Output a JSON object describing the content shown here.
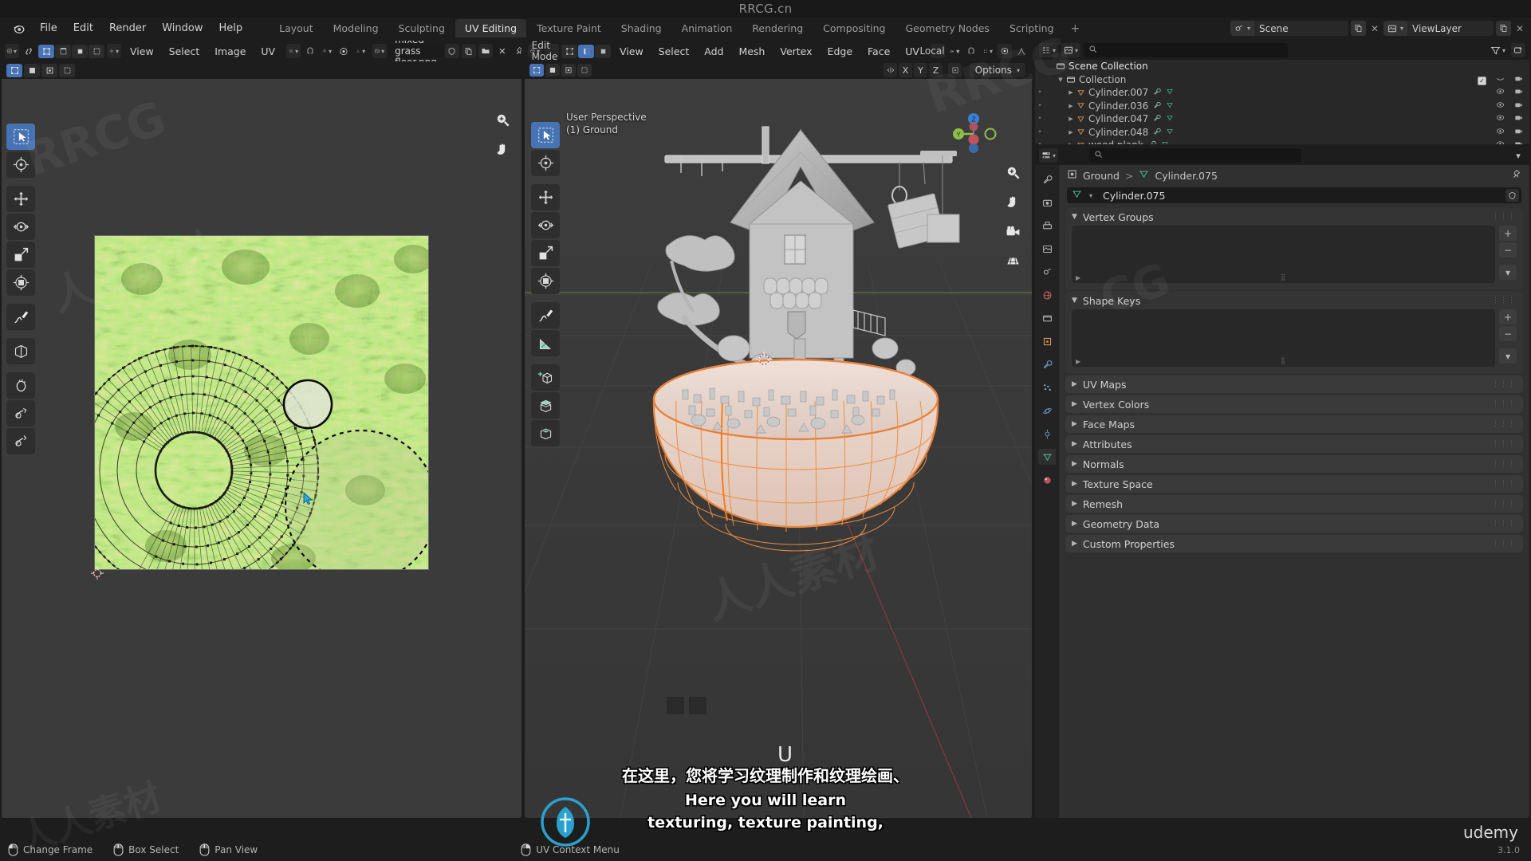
{
  "window": {
    "title": "RRCG.cn",
    "version": "3.1.0",
    "brand": "udemy"
  },
  "topbar": {
    "logo_icon": "blender-logo-icon",
    "menus": [
      "File",
      "Edit",
      "Render",
      "Window",
      "Help"
    ],
    "workspaces": [
      "Layout",
      "Modeling",
      "Sculpting",
      "UV Editing",
      "Texture Paint",
      "Shading",
      "Animation",
      "Rendering",
      "Compositing",
      "Geometry Nodes",
      "Scripting"
    ],
    "active_workspace": "UV Editing",
    "add_workspace_label": "+",
    "scene": {
      "icon": "scene-icon",
      "name": "Scene",
      "new_icon": "duplicate-icon",
      "remove_icon": "close-icon"
    },
    "viewlayer": {
      "icon": "viewlayer-icon",
      "name": "ViewLayer",
      "new_icon": "duplicate-icon",
      "remove_icon": "close-icon"
    }
  },
  "uv_editor": {
    "editor_type_icon": "uv-editor-icon",
    "mode_icon": "uv-sync-icon",
    "select_modes": [
      "vertex-select-icon",
      "edge-select-icon",
      "face-select-icon",
      "island-select-icon"
    ],
    "active_select_mode": 0,
    "pivot_icon": "pivot-icon",
    "menus": [
      "View",
      "Select",
      "Image",
      "UV"
    ],
    "snap_icon": "snap-magnet-icon",
    "proportional_icon": "proportional-edit-icon",
    "image_browse_icon": "image-browse-icon",
    "image_name": "mixed grass floor.png",
    "image_buttons": [
      "fake-user-shield-icon",
      "new-image-icon",
      "open-image-icon",
      "unlink-icon",
      "pin-icon"
    ],
    "zoom_icon": "zoom-icon",
    "pan_icon": "hand-pan-icon",
    "tools": [
      "tweak-select-tool-icon",
      "cursor-tool-icon",
      "move-tool-icon",
      "rotate-tool-icon",
      "scale-tool-icon",
      "transform-tool-icon",
      "annotate-tool-icon",
      "rip-region-tool-icon",
      "grab-tool-icon",
      "relax-tool-icon",
      "pinch-tool-icon"
    ],
    "active_tool": 0
  },
  "viewport3d": {
    "editor_type_icon": "3d-viewport-icon",
    "mode_icon": "editmode-icon",
    "mode": "Edit Mode",
    "select_modes": [
      "vertex-select-icon",
      "edge-select-icon",
      "face-select-icon"
    ],
    "active_select_mode": 1,
    "menus": [
      "View",
      "Select",
      "Add",
      "Mesh",
      "Vertex",
      "Edge",
      "Face",
      "UV"
    ],
    "transform_orientation": "Local",
    "orientation_icon": "orientation-icon",
    "pivot_icon": "pivot-point-icon",
    "snap_icon": "snap-magnet-icon",
    "snap_options_icon": "snap-settings-icon",
    "proportional_icon": "proportional-edit-icon",
    "proportional_falloff_icon": "falloff-curve-icon",
    "mirror_label": "Mirror",
    "mirror_axes": [
      "X",
      "Y",
      "Z"
    ],
    "mirror_icon": "mirror-icon",
    "mirror_topology_icon": "topology-mirror-icon",
    "options_label": "Options",
    "overlay_line1": "User Perspective",
    "overlay_line2": "(1) Ground",
    "gizmo_axes": [
      "Z",
      "Y",
      "X"
    ],
    "side_icons": [
      "zoom-icon",
      "hand-pan-icon",
      "camera-view-icon",
      "toggle-ortho-icon"
    ],
    "tools": [
      "tweak-select-tool-icon",
      "cursor-tool-icon",
      "move-tool-icon",
      "rotate-tool-icon",
      "scale-tool-icon",
      "transform-tool-icon",
      "annotate-tool-icon",
      "measure-tool-icon",
      "add-cube-tool-icon",
      "extrude-region-tool-icon",
      "inset-faces-tool-icon",
      "bevel-tool-icon",
      "loop-cut-tool-icon",
      "knife-tool-icon",
      "poly-build-tool-icon",
      "spin-tool-icon",
      "smooth-tool-icon",
      "edge-slide-tool-icon",
      "shrink-fatten-tool-icon",
      "shear-tool-icon"
    ],
    "active_tool": 0,
    "operator_key_hint": "U"
  },
  "outliner": {
    "display_mode_icon": "outliner-display-icon",
    "filter_id_icon": "viewlayer-icon",
    "search_icon": "search-icon",
    "search_placeholder": "",
    "filter_icon": "filter-funnel-icon",
    "new_collection_icon": "new-collection-icon",
    "rows": [
      {
        "label": "Scene Collection",
        "icon": "scene-collection-icon",
        "indent": 0,
        "expander": "",
        "has_checkbox": false
      },
      {
        "label": "Collection",
        "icon": "collection-icon",
        "indent": 1,
        "expander": "down",
        "has_checkbox": true
      },
      {
        "label": "Cylinder.007",
        "icon": "mesh-object-icon",
        "indent": 2,
        "expander": "right",
        "has_checkbox": false
      },
      {
        "label": "Cylinder.036",
        "icon": "mesh-object-icon",
        "indent": 2,
        "expander": "right",
        "has_checkbox": false
      },
      {
        "label": "Cylinder.047",
        "icon": "mesh-object-icon",
        "indent": 2,
        "expander": "right",
        "has_checkbox": false
      },
      {
        "label": "Cylinder.048",
        "icon": "mesh-object-icon",
        "indent": 2,
        "expander": "right",
        "has_checkbox": false
      },
      {
        "label": "wood plank",
        "icon": "mesh-object-icon",
        "indent": 2,
        "expander": "right",
        "has_checkbox": false
      }
    ]
  },
  "properties": {
    "editor_icon": "properties-editor-icon",
    "search_icon": "search-icon",
    "search_placeholder": "",
    "expand_icon": "chevron-down-icon",
    "tabs": [
      "tool-icon",
      "render-icon",
      "output-icon",
      "viewlayer-props-icon",
      "scene-props-icon",
      "world-props-icon",
      "collection-props-icon",
      "object-props-icon",
      "modifier-props-icon",
      "particles-props-icon",
      "physics-props-icon",
      "constraints-props-icon",
      "data-props-icon",
      "material-props-icon"
    ],
    "active_tab": 12,
    "breadcrumb": {
      "object_icon": "object-icon",
      "object": "Ground",
      "sep": ">",
      "data_icon": "mesh-data-icon",
      "data": "Cylinder.075"
    },
    "pin_icon": "pin-icon",
    "name_field": {
      "icon": "mesh-data-icon",
      "value": "Cylinder.075",
      "fake_user_icon": "shield-icon"
    },
    "panels": [
      {
        "label": "Vertex Groups",
        "open": true,
        "type": "list",
        "items": [],
        "buttons": [
          "+",
          "−",
          "chevron-down-icon"
        ]
      },
      {
        "label": "Shape Keys",
        "open": true,
        "type": "list",
        "items": [],
        "buttons": [
          "+",
          "−",
          "chevron-down-icon"
        ]
      },
      {
        "label": "UV Maps",
        "open": false
      },
      {
        "label": "Vertex Colors",
        "open": false
      },
      {
        "label": "Face Maps",
        "open": false
      },
      {
        "label": "Attributes",
        "open": false
      },
      {
        "label": "Normals",
        "open": false
      },
      {
        "label": "Texture Space",
        "open": false
      },
      {
        "label": "Remesh",
        "open": false
      },
      {
        "label": "Geometry Data",
        "open": false
      },
      {
        "label": "Custom Properties",
        "open": false
      }
    ]
  },
  "statusbar": {
    "items": [
      {
        "icon": "mouse-left-icon",
        "label": "Change Frame"
      },
      {
        "icon": "mouse-middle-icon",
        "label": "Box Select"
      },
      {
        "icon": "mouse-middle-icon",
        "label": "Pan View"
      },
      {
        "icon": "mouse-right-icon",
        "label": "UV Context Menu"
      }
    ]
  },
  "subtitles": {
    "chinese": "在这里，您将学习纹理制作和纹理绘画、",
    "english_line1": "Here you will learn",
    "english_line2": "texturing, texture painting,"
  },
  "watermarks": {
    "primary": "RRCG",
    "secondary": "人人素材",
    "badge": "RRCG.cn"
  },
  "colors": {
    "accent_blue": "#4772b3",
    "selection_orange": "#e8813a",
    "axis_x": "#c44c52",
    "axis_y": "#8fbe4a",
    "axis_z": "#3b7fd4",
    "panel_bg": "#303030",
    "header_bg": "#1d1d1d",
    "mesh_data_green": "#3d9970"
  }
}
